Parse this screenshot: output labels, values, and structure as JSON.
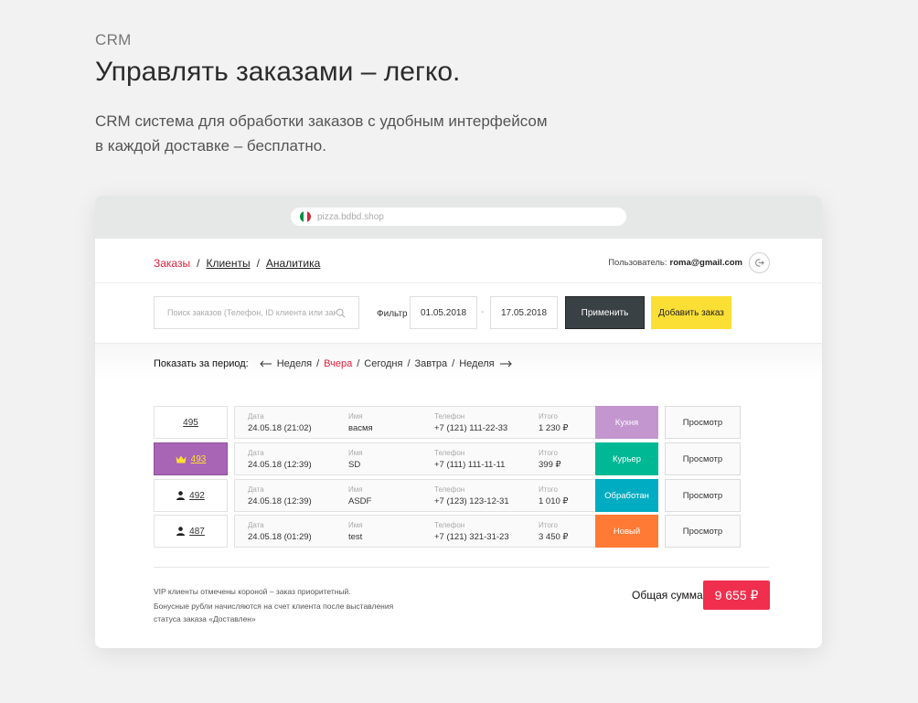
{
  "hero": {
    "tag": "CRM",
    "title": "Управлять заказами – легко.",
    "desc_line1": "CRM система для обработки заказов с удобным интерфейсом",
    "desc_line2": "в каждой доставке – бесплатно."
  },
  "browser": {
    "url": "pizza.bdbd.shop",
    "flag_colors": [
      "#009246",
      "#ffffff",
      "#ce2b37"
    ]
  },
  "nav": {
    "crumbs": [
      {
        "label": "Заказы",
        "active": true
      },
      {
        "label": "Клиенты",
        "active": false
      },
      {
        "label": "Аналитика",
        "active": false
      }
    ],
    "separator": "/",
    "user_label": "Пользователь:",
    "user_email": "roma@gmail.com"
  },
  "filters": {
    "search_placeholder": "Поиск заказов (Телефон, ID клиента или заказа)",
    "filter_label": "Фильтр",
    "date_from": "01.05.2018",
    "date_dash": "-",
    "date_to": "17.05.2018",
    "apply_label": "Применить",
    "add_label": "Добавить заказ"
  },
  "period": {
    "label": "Показать за период:",
    "items": [
      {
        "label": "Неделя",
        "active": false
      },
      {
        "label": "Вчера",
        "active": true
      },
      {
        "label": "Сегодня",
        "active": false
      },
      {
        "label": "Завтра",
        "active": false
      },
      {
        "label": "Неделя",
        "active": false
      }
    ],
    "separator": "/"
  },
  "columns": {
    "date": "Дата",
    "name": "Имя",
    "phone": "Телефон",
    "total": "Итого"
  },
  "orders": [
    {
      "id": "495",
      "icon": "none",
      "vip": false,
      "date": "24.05.18 (21:02)",
      "name": "васмя",
      "phone": "+7 (121) 111-22-33",
      "total": "1 230 ₽",
      "status": "Кухня",
      "status_color": "#c396cf",
      "view_label": "Просмотр"
    },
    {
      "id": "493",
      "icon": "crown-icon",
      "vip": true,
      "date": "24.05.18 (12:39)",
      "name": "SD",
      "phone": "+7 (111) 111-11-11",
      "total": "399 ₽",
      "status": "Курьер",
      "status_color": "#00b894",
      "view_label": "Просмотр"
    },
    {
      "id": "492",
      "icon": "user-icon",
      "vip": false,
      "date": "24.05.18 (12:39)",
      "name": "ASDF",
      "phone": "+7 (123) 123-12-31",
      "total": "1 010 ₽",
      "status": "Обработан",
      "status_color": "#00acc1",
      "view_label": "Просмотр"
    },
    {
      "id": "487",
      "icon": "user-icon",
      "vip": false,
      "date": "24.05.18 (01:29)",
      "name": "test",
      "phone": "+7 (121) 321-31-23",
      "total": "3 450 ₽",
      "status": "Новый",
      "status_color": "#ff7a35",
      "view_label": "Просмотр"
    }
  ],
  "footer": {
    "note1": "VIP клиенты отмечены короной – заказ приоритетный.",
    "note2": "Бонусные рубли начисляются на счет клиента после выставления статуса заказа «Доставлен»",
    "total_label": "Общая сумма",
    "total_value": "9 655 ₽",
    "total_color": "#ef2f4d"
  }
}
